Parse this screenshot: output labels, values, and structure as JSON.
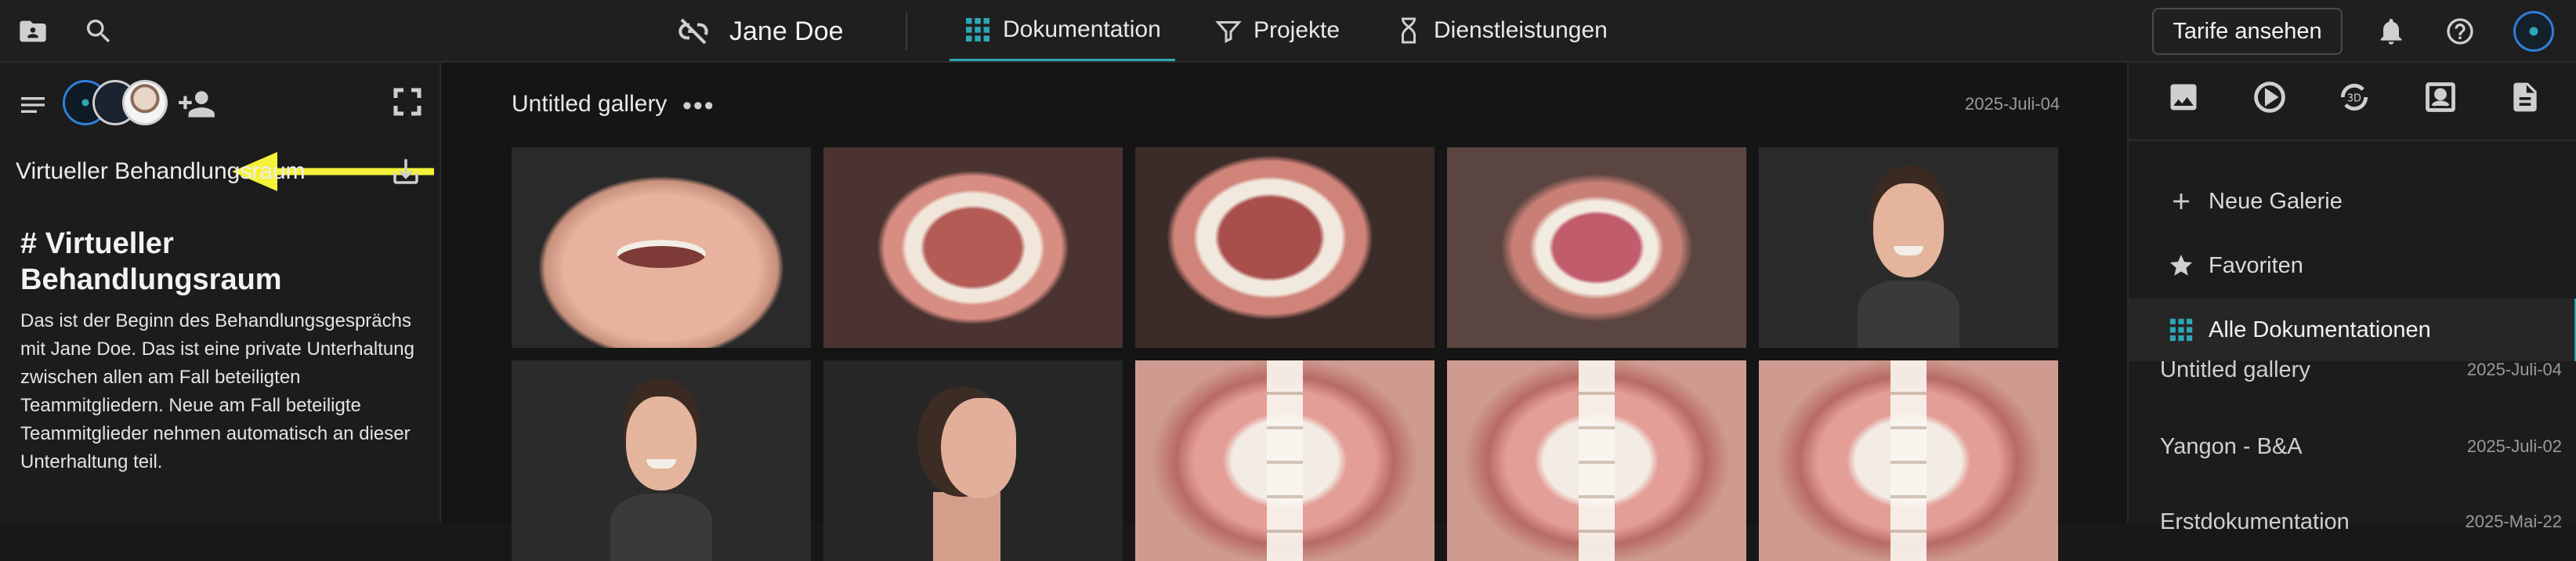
{
  "topbar": {
    "patient_name": "Jane Doe",
    "nav": [
      {
        "label": "Dokumentation",
        "icon": "grid-icon",
        "active": true
      },
      {
        "label": "Projekte",
        "icon": "filter-list-icon",
        "active": false
      },
      {
        "label": "Dienstleistungen",
        "icon": "hourglass-icon",
        "active": false
      }
    ],
    "tarife_label": "Tarife ansehen",
    "accent": "#2ea7b5"
  },
  "left_panel": {
    "room_title": "Virtueller Behandlungsraum",
    "heading": "# Virtueller Behandlungsraum",
    "body": "Das ist der Beginn des Behandlungsgesprächs mit Jane Doe. Das ist eine private Unterhaltung zwischen allen am Fall beteiligten Teammitgliedern. Neue am Fall beteiligte Teammitglieder nehmen automatisch an dieser Unterhaltung teil.",
    "annotation_color": "#f5f23a"
  },
  "gallery": {
    "title": "Untitled gallery",
    "date": "2025-Juli-04",
    "more": "•••"
  },
  "right_panel": {
    "menu": [
      {
        "label": "Neue Galerie",
        "icon": "plus-icon",
        "active": false
      },
      {
        "label": "Favoriten",
        "icon": "star-icon",
        "active": false
      },
      {
        "label": "Alle Dokumentationen",
        "icon": "grid-icon",
        "active": true
      }
    ],
    "galleries": [
      {
        "name": "Untitled gallery",
        "date": "2025-Juli-04"
      },
      {
        "name": "Yangon - B&A",
        "date": "2025-Juli-02"
      },
      {
        "name": "Erstdokumentation",
        "date": "2025-Mai-22"
      }
    ]
  }
}
